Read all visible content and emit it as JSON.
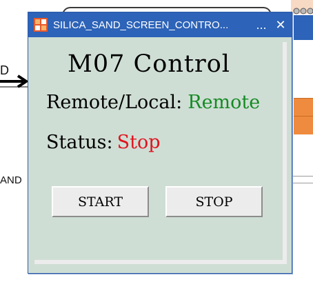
{
  "background": {
    "left_partial_label": "D",
    "sand_partial_label": "AND",
    "colors": {
      "pipe": "#3a3a3a",
      "blue": "#2d63b8",
      "orange": "#ef8b3e"
    }
  },
  "window": {
    "title": "SILICA_SAND_SCREEN_CONTRO...",
    "minimize_symbol": "...",
    "close_symbol": "✕",
    "icon": "app-icon",
    "colors": {
      "titlebar": "#2d63b8",
      "panel": "#cfded5"
    }
  },
  "control": {
    "heading": "M07 Control",
    "remote_local_label": "Remote/Local:",
    "remote_local_value": "Remote",
    "status_label": "Status:",
    "status_value": "Stop",
    "start_label": "START",
    "stop_label": "STOP",
    "colors": {
      "remote": "#158a23",
      "stop": "#e0141e"
    }
  }
}
